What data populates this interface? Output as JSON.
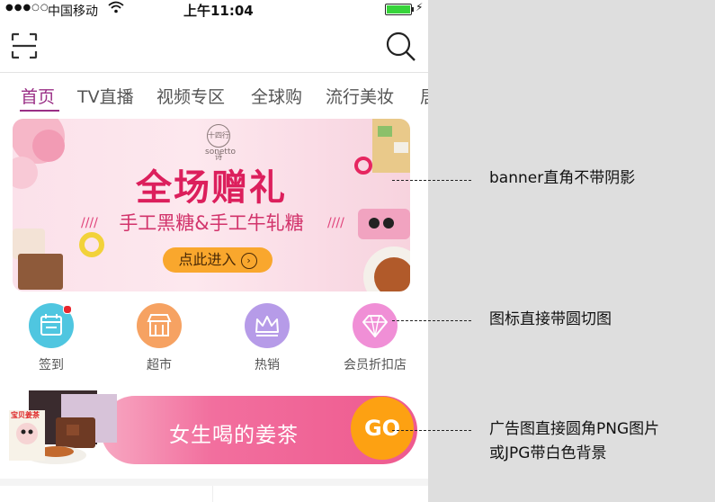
{
  "status_bar": {
    "carrier": "中国移动",
    "time": "上午11:04"
  },
  "tabs": [
    {
      "label": "首页"
    },
    {
      "label": "TV直播"
    },
    {
      "label": "视频专区"
    },
    {
      "label": "全球购"
    },
    {
      "label": "流行美妆"
    },
    {
      "label": "居"
    }
  ],
  "banner": {
    "logo_text": "十四行诗",
    "logo_sub": "sonetto",
    "title": "全场赠礼",
    "subtitle": "手工黑糖&手工牛轧糖",
    "cta": "点此进入"
  },
  "icons": [
    {
      "label": "签到",
      "color": "#4fc6e0"
    },
    {
      "label": "超市",
      "color": "#f6a262"
    },
    {
      "label": "热销",
      "color": "#b69be8"
    },
    {
      "label": "会员折扣店",
      "color": "#f08fd6"
    }
  ],
  "ad": {
    "product_text": "宝贝姜茶",
    "text": "女生喝的姜茶",
    "go": "GO"
  },
  "annotations": [
    {
      "text": "banner直角不带阴影"
    },
    {
      "text": "图标直接带圆切图"
    },
    {
      "line1": "广告图直接圆角PNG图片",
      "line2": "或JPG带白色背景"
    }
  ],
  "colors": {
    "accent": "#9a2f86",
    "banner_title": "#dc1f5c",
    "cta": "#f9a72d",
    "go": "#fda112"
  }
}
